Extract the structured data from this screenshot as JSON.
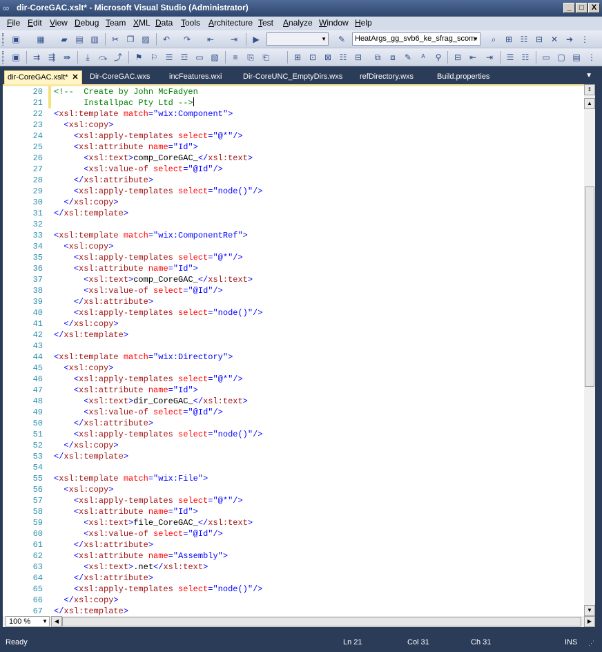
{
  "window": {
    "title": "dir-CoreGAC.xslt* - Microsoft Visual Studio (Administrator)",
    "minimize": "_",
    "maximize": "□",
    "close": "X"
  },
  "menu": [
    "File",
    "Edit",
    "View",
    "Debug",
    "Team",
    "XML",
    "Data",
    "Tools",
    "Architecture",
    "Test",
    "Analyze",
    "Window",
    "Help"
  ],
  "toolbar": {
    "solution_config": "",
    "find_text": "HeatArgs_gg_svb6_ke_sfrag_scom"
  },
  "tabs": [
    {
      "label": "dir-CoreGAC.xslt*",
      "active": true,
      "close": "✕"
    },
    {
      "label": "Dir-CoreGAC.wxs"
    },
    {
      "label": "incFeatures.wxi"
    },
    {
      "label": "Dir-CoreUNC_EmptyDirs.wxs"
    },
    {
      "label": "refDirectory.wxs"
    },
    {
      "label": "Build.properties"
    }
  ],
  "lines": [
    {
      "n": "20",
      "parts": [
        [
          "c",
          "<!--  Create by John McFadyen"
        ]
      ]
    },
    {
      "n": "21",
      "parts": [
        [
          "c",
          "      Installpac Pty Ltd -->"
        ]
      ]
    },
    {
      "n": "22",
      "parts": [
        [
          "b",
          "<"
        ],
        [
          "m",
          "xsl:template"
        ],
        [
          "x",
          " "
        ],
        [
          "a",
          "match"
        ],
        [
          "b",
          "=\""
        ],
        [
          "v",
          "wix:Component"
        ],
        [
          "b",
          "\">"
        ]
      ]
    },
    {
      "n": "23",
      "parts": [
        [
          "x",
          "  "
        ],
        [
          "b",
          "<"
        ],
        [
          "m",
          "xsl:copy"
        ],
        [
          "b",
          ">"
        ]
      ]
    },
    {
      "n": "24",
      "parts": [
        [
          "x",
          "    "
        ],
        [
          "b",
          "<"
        ],
        [
          "m",
          "xsl:apply-templates"
        ],
        [
          "x",
          " "
        ],
        [
          "a",
          "select"
        ],
        [
          "b",
          "=\""
        ],
        [
          "v",
          "@*"
        ],
        [
          "b",
          "\"/>"
        ]
      ]
    },
    {
      "n": "25",
      "parts": [
        [
          "x",
          "    "
        ],
        [
          "b",
          "<"
        ],
        [
          "m",
          "xsl:attribute"
        ],
        [
          "x",
          " "
        ],
        [
          "a",
          "name"
        ],
        [
          "b",
          "=\""
        ],
        [
          "v",
          "Id"
        ],
        [
          "b",
          "\">"
        ]
      ]
    },
    {
      "n": "26",
      "parts": [
        [
          "x",
          "      "
        ],
        [
          "b",
          "<"
        ],
        [
          "m",
          "xsl:text"
        ],
        [
          "b",
          ">"
        ],
        [
          "x",
          "comp_CoreGAC_"
        ],
        [
          "b",
          "</"
        ],
        [
          "m",
          "xsl:text"
        ],
        [
          "b",
          ">"
        ]
      ]
    },
    {
      "n": "27",
      "parts": [
        [
          "x",
          "      "
        ],
        [
          "b",
          "<"
        ],
        [
          "m",
          "xsl:value-of"
        ],
        [
          "x",
          " "
        ],
        [
          "a",
          "select"
        ],
        [
          "b",
          "=\""
        ],
        [
          "v",
          "@Id"
        ],
        [
          "b",
          "\"/>"
        ]
      ]
    },
    {
      "n": "28",
      "parts": [
        [
          "x",
          "    "
        ],
        [
          "b",
          "</"
        ],
        [
          "m",
          "xsl:attribute"
        ],
        [
          "b",
          ">"
        ]
      ]
    },
    {
      "n": "29",
      "parts": [
        [
          "x",
          "    "
        ],
        [
          "b",
          "<"
        ],
        [
          "m",
          "xsl:apply-templates"
        ],
        [
          "x",
          " "
        ],
        [
          "a",
          "select"
        ],
        [
          "b",
          "=\""
        ],
        [
          "v",
          "node()"
        ],
        [
          "b",
          "\"/>"
        ]
      ]
    },
    {
      "n": "30",
      "parts": [
        [
          "x",
          "  "
        ],
        [
          "b",
          "</"
        ],
        [
          "m",
          "xsl:copy"
        ],
        [
          "b",
          ">"
        ]
      ]
    },
    {
      "n": "31",
      "parts": [
        [
          "b",
          "</"
        ],
        [
          "m",
          "xsl:template"
        ],
        [
          "b",
          ">"
        ]
      ]
    },
    {
      "n": "32",
      "parts": []
    },
    {
      "n": "33",
      "parts": [
        [
          "b",
          "<"
        ],
        [
          "m",
          "xsl:template"
        ],
        [
          "x",
          " "
        ],
        [
          "a",
          "match"
        ],
        [
          "b",
          "=\""
        ],
        [
          "v",
          "wix:ComponentRef"
        ],
        [
          "b",
          "\">"
        ]
      ]
    },
    {
      "n": "34",
      "parts": [
        [
          "x",
          "  "
        ],
        [
          "b",
          "<"
        ],
        [
          "m",
          "xsl:copy"
        ],
        [
          "b",
          ">"
        ]
      ]
    },
    {
      "n": "35",
      "parts": [
        [
          "x",
          "    "
        ],
        [
          "b",
          "<"
        ],
        [
          "m",
          "xsl:apply-templates"
        ],
        [
          "x",
          " "
        ],
        [
          "a",
          "select"
        ],
        [
          "b",
          "=\""
        ],
        [
          "v",
          "@*"
        ],
        [
          "b",
          "\"/>"
        ]
      ]
    },
    {
      "n": "36",
      "parts": [
        [
          "x",
          "    "
        ],
        [
          "b",
          "<"
        ],
        [
          "m",
          "xsl:attribute"
        ],
        [
          "x",
          " "
        ],
        [
          "a",
          "name"
        ],
        [
          "b",
          "=\""
        ],
        [
          "v",
          "Id"
        ],
        [
          "b",
          "\">"
        ]
      ]
    },
    {
      "n": "37",
      "parts": [
        [
          "x",
          "      "
        ],
        [
          "b",
          "<"
        ],
        [
          "m",
          "xsl:text"
        ],
        [
          "b",
          ">"
        ],
        [
          "x",
          "comp_CoreGAC_"
        ],
        [
          "b",
          "</"
        ],
        [
          "m",
          "xsl:text"
        ],
        [
          "b",
          ">"
        ]
      ]
    },
    {
      "n": "38",
      "parts": [
        [
          "x",
          "      "
        ],
        [
          "b",
          "<"
        ],
        [
          "m",
          "xsl:value-of"
        ],
        [
          "x",
          " "
        ],
        [
          "a",
          "select"
        ],
        [
          "b",
          "=\""
        ],
        [
          "v",
          "@Id"
        ],
        [
          "b",
          "\"/>"
        ]
      ]
    },
    {
      "n": "39",
      "parts": [
        [
          "x",
          "    "
        ],
        [
          "b",
          "</"
        ],
        [
          "m",
          "xsl:attribute"
        ],
        [
          "b",
          ">"
        ]
      ]
    },
    {
      "n": "40",
      "parts": [
        [
          "x",
          "    "
        ],
        [
          "b",
          "<"
        ],
        [
          "m",
          "xsl:apply-templates"
        ],
        [
          "x",
          " "
        ],
        [
          "a",
          "select"
        ],
        [
          "b",
          "=\""
        ],
        [
          "v",
          "node()"
        ],
        [
          "b",
          "\"/>"
        ]
      ]
    },
    {
      "n": "41",
      "parts": [
        [
          "x",
          "  "
        ],
        [
          "b",
          "</"
        ],
        [
          "m",
          "xsl:copy"
        ],
        [
          "b",
          ">"
        ]
      ]
    },
    {
      "n": "42",
      "parts": [
        [
          "b",
          "</"
        ],
        [
          "m",
          "xsl:template"
        ],
        [
          "b",
          ">"
        ]
      ]
    },
    {
      "n": "43",
      "parts": []
    },
    {
      "n": "44",
      "parts": [
        [
          "b",
          "<"
        ],
        [
          "m",
          "xsl:template"
        ],
        [
          "x",
          " "
        ],
        [
          "a",
          "match"
        ],
        [
          "b",
          "=\""
        ],
        [
          "v",
          "wix:Directory"
        ],
        [
          "b",
          "\">"
        ]
      ]
    },
    {
      "n": "45",
      "parts": [
        [
          "x",
          "  "
        ],
        [
          "b",
          "<"
        ],
        [
          "m",
          "xsl:copy"
        ],
        [
          "b",
          ">"
        ]
      ]
    },
    {
      "n": "46",
      "parts": [
        [
          "x",
          "    "
        ],
        [
          "b",
          "<"
        ],
        [
          "m",
          "xsl:apply-templates"
        ],
        [
          "x",
          " "
        ],
        [
          "a",
          "select"
        ],
        [
          "b",
          "=\""
        ],
        [
          "v",
          "@*"
        ],
        [
          "b",
          "\"/>"
        ]
      ]
    },
    {
      "n": "47",
      "parts": [
        [
          "x",
          "    "
        ],
        [
          "b",
          "<"
        ],
        [
          "m",
          "xsl:attribute"
        ],
        [
          "x",
          " "
        ],
        [
          "a",
          "name"
        ],
        [
          "b",
          "=\""
        ],
        [
          "v",
          "Id"
        ],
        [
          "b",
          "\">"
        ]
      ]
    },
    {
      "n": "48",
      "parts": [
        [
          "x",
          "      "
        ],
        [
          "b",
          "<"
        ],
        [
          "m",
          "xsl:text"
        ],
        [
          "b",
          ">"
        ],
        [
          "x",
          "dir_CoreGAC_"
        ],
        [
          "b",
          "</"
        ],
        [
          "m",
          "xsl:text"
        ],
        [
          "b",
          ">"
        ]
      ]
    },
    {
      "n": "49",
      "parts": [
        [
          "x",
          "      "
        ],
        [
          "b",
          "<"
        ],
        [
          "m",
          "xsl:value-of"
        ],
        [
          "x",
          " "
        ],
        [
          "a",
          "select"
        ],
        [
          "b",
          "=\""
        ],
        [
          "v",
          "@Id"
        ],
        [
          "b",
          "\"/>"
        ]
      ]
    },
    {
      "n": "50",
      "parts": [
        [
          "x",
          "    "
        ],
        [
          "b",
          "</"
        ],
        [
          "m",
          "xsl:attribute"
        ],
        [
          "b",
          ">"
        ]
      ]
    },
    {
      "n": "51",
      "parts": [
        [
          "x",
          "    "
        ],
        [
          "b",
          "<"
        ],
        [
          "m",
          "xsl:apply-templates"
        ],
        [
          "x",
          " "
        ],
        [
          "a",
          "select"
        ],
        [
          "b",
          "=\""
        ],
        [
          "v",
          "node()"
        ],
        [
          "b",
          "\"/>"
        ]
      ]
    },
    {
      "n": "52",
      "parts": [
        [
          "x",
          "  "
        ],
        [
          "b",
          "</"
        ],
        [
          "m",
          "xsl:copy"
        ],
        [
          "b",
          ">"
        ]
      ]
    },
    {
      "n": "53",
      "parts": [
        [
          "b",
          "</"
        ],
        [
          "m",
          "xsl:template"
        ],
        [
          "b",
          ">"
        ]
      ]
    },
    {
      "n": "54",
      "parts": []
    },
    {
      "n": "55",
      "parts": [
        [
          "b",
          "<"
        ],
        [
          "m",
          "xsl:template"
        ],
        [
          "x",
          " "
        ],
        [
          "a",
          "match"
        ],
        [
          "b",
          "=\""
        ],
        [
          "v",
          "wix:File"
        ],
        [
          "b",
          "\">"
        ]
      ]
    },
    {
      "n": "56",
      "parts": [
        [
          "x",
          "  "
        ],
        [
          "b",
          "<"
        ],
        [
          "m",
          "xsl:copy"
        ],
        [
          "b",
          ">"
        ]
      ]
    },
    {
      "n": "57",
      "parts": [
        [
          "x",
          "    "
        ],
        [
          "b",
          "<"
        ],
        [
          "m",
          "xsl:apply-templates"
        ],
        [
          "x",
          " "
        ],
        [
          "a",
          "select"
        ],
        [
          "b",
          "=\""
        ],
        [
          "v",
          "@*"
        ],
        [
          "b",
          "\"/>"
        ]
      ]
    },
    {
      "n": "58",
      "parts": [
        [
          "x",
          "    "
        ],
        [
          "b",
          "<"
        ],
        [
          "m",
          "xsl:attribute"
        ],
        [
          "x",
          " "
        ],
        [
          "a",
          "name"
        ],
        [
          "b",
          "=\""
        ],
        [
          "v",
          "Id"
        ],
        [
          "b",
          "\">"
        ]
      ]
    },
    {
      "n": "59",
      "parts": [
        [
          "x",
          "      "
        ],
        [
          "b",
          "<"
        ],
        [
          "m",
          "xsl:text"
        ],
        [
          "b",
          ">"
        ],
        [
          "x",
          "file_CoreGAC_"
        ],
        [
          "b",
          "</"
        ],
        [
          "m",
          "xsl:text"
        ],
        [
          "b",
          ">"
        ]
      ]
    },
    {
      "n": "60",
      "parts": [
        [
          "x",
          "      "
        ],
        [
          "b",
          "<"
        ],
        [
          "m",
          "xsl:value-of"
        ],
        [
          "x",
          " "
        ],
        [
          "a",
          "select"
        ],
        [
          "b",
          "=\""
        ],
        [
          "v",
          "@Id"
        ],
        [
          "b",
          "\"/>"
        ]
      ]
    },
    {
      "n": "61",
      "parts": [
        [
          "x",
          "    "
        ],
        [
          "b",
          "</"
        ],
        [
          "m",
          "xsl:attribute"
        ],
        [
          "b",
          ">"
        ]
      ]
    },
    {
      "n": "62",
      "parts": [
        [
          "x",
          "    "
        ],
        [
          "b",
          "<"
        ],
        [
          "m",
          "xsl:attribute"
        ],
        [
          "x",
          " "
        ],
        [
          "a",
          "name"
        ],
        [
          "b",
          "=\""
        ],
        [
          "v",
          "Assembly"
        ],
        [
          "b",
          "\">"
        ]
      ]
    },
    {
      "n": "63",
      "parts": [
        [
          "x",
          "      "
        ],
        [
          "b",
          "<"
        ],
        [
          "m",
          "xsl:text"
        ],
        [
          "b",
          ">"
        ],
        [
          "x",
          ".net"
        ],
        [
          "b",
          "</"
        ],
        [
          "m",
          "xsl:text"
        ],
        [
          "b",
          ">"
        ]
      ]
    },
    {
      "n": "64",
      "parts": [
        [
          "x",
          "    "
        ],
        [
          "b",
          "</"
        ],
        [
          "m",
          "xsl:attribute"
        ],
        [
          "b",
          ">"
        ]
      ]
    },
    {
      "n": "65",
      "parts": [
        [
          "x",
          "    "
        ],
        [
          "b",
          "<"
        ],
        [
          "m",
          "xsl:apply-templates"
        ],
        [
          "x",
          " "
        ],
        [
          "a",
          "select"
        ],
        [
          "b",
          "=\""
        ],
        [
          "v",
          "node()"
        ],
        [
          "b",
          "\"/>"
        ]
      ]
    },
    {
      "n": "66",
      "parts": [
        [
          "x",
          "  "
        ],
        [
          "b",
          "</"
        ],
        [
          "m",
          "xsl:copy"
        ],
        [
          "b",
          ">"
        ]
      ]
    },
    {
      "n": "67",
      "parts": [
        [
          "b",
          "</"
        ],
        [
          "m",
          "xsl:template"
        ],
        [
          "b",
          ">"
        ]
      ]
    }
  ],
  "zoom": "100 %",
  "status": {
    "state": "Ready",
    "ln": "Ln 21",
    "col": "Col 31",
    "ch": "Ch 31",
    "mode": "INS"
  }
}
